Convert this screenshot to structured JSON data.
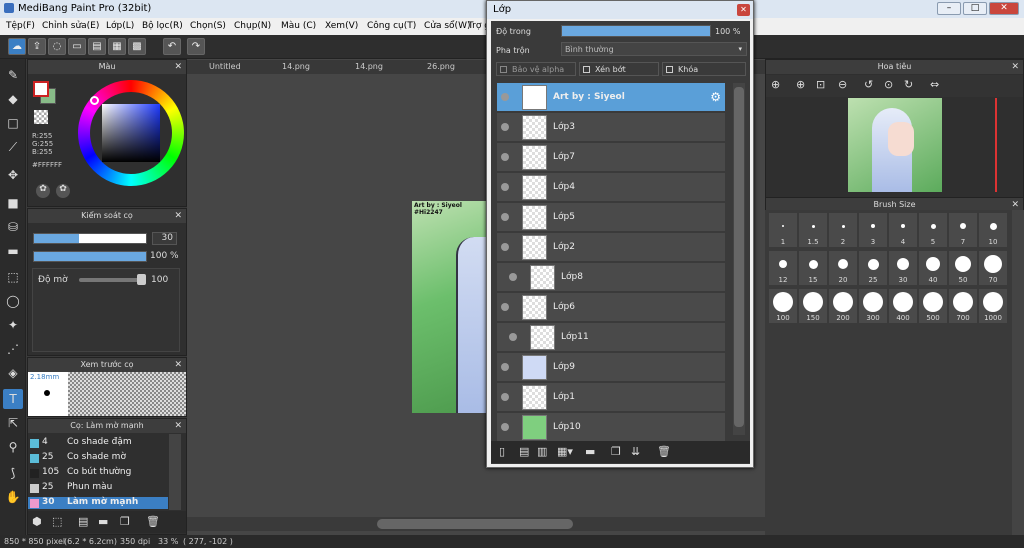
{
  "app": {
    "title": "MediBang Paint Pro (32bit)"
  },
  "menu": [
    "Tệp(F)",
    "Chỉnh sửa(E)",
    "Lớp(L)",
    "Bộ lọc(R)",
    "Chọn(S)",
    "Chụp(N)",
    "Màu (C)",
    "Xem(V)",
    "Công cụ(T)",
    "Cửa sổ(W)",
    "Trợ giúp(H)"
  ],
  "color_panel": {
    "title": "Màu",
    "r": "R:255",
    "g": "G:255",
    "b": "B:255",
    "hex": "#FFFFFF",
    "fg": "#cc2222",
    "bg": "#88bb88"
  },
  "brush_control": {
    "title": "Kiểm soát cọ",
    "size": "30",
    "opacity_pct": "100 %",
    "opacity_label": "Độ mờ",
    "opacity_value": "100",
    "size_fraction": 0.4,
    "opacity_fraction": 1.0
  },
  "brush_preview": {
    "title": "Xem trước cọ",
    "size_label": "2.18mm"
  },
  "brush_list": {
    "title": "Cọ: Làm mờ mạnh",
    "items": [
      {
        "n": "4",
        "label": "Co shade đậm",
        "color": "#5bbcd8"
      },
      {
        "n": "25",
        "label": "Co shade mờ",
        "color": "#5bbcd8"
      },
      {
        "n": "105",
        "label": "Co bút thường",
        "color": "#222222"
      },
      {
        "n": "25",
        "label": "Phun màu",
        "color": "#cccccc"
      },
      {
        "n": "30",
        "label": "Làm mờ mạnh",
        "color": "#ee99cc"
      }
    ]
  },
  "canvas_tabs": [
    "Untitled",
    "14.png",
    "14.png",
    "26.png"
  ],
  "artwork": {
    "credit": "Art by : Siyeol",
    "tag": "#Hi2247"
  },
  "layer_window": {
    "title": "Lớp",
    "opacity_label": "Độ trong",
    "opacity_value": "100 %",
    "opacity_fraction": 1.0,
    "blend_label": "Pha trộn",
    "blend_value": "Bình thường",
    "protect_alpha": "Bảo vệ alpha",
    "clip": "Xén bớt",
    "lock": "Khóa",
    "layers": [
      "Art by : Siyeol",
      "Lớp3",
      "Lớp7",
      "Lớp4",
      "Lớp5",
      "Lớp2",
      "Lớp8",
      "Lớp6",
      "Lớp11",
      "Lớp9",
      "Lớp1",
      "Lớp10"
    ]
  },
  "navigator": {
    "title": "Hoa tiêu"
  },
  "brush_size": {
    "title": "Brush Size",
    "sizes": [
      "1",
      "1.5",
      "2",
      "3",
      "4",
      "5",
      "7",
      "10",
      "12",
      "15",
      "20",
      "25",
      "30",
      "40",
      "50",
      "70",
      "100",
      "150",
      "200",
      "300",
      "400",
      "500",
      "700",
      "1000"
    ]
  },
  "status": {
    "pixels": "850 * 850 pixel",
    "cm": "(6.2 * 6.2cm)",
    "dpi": "350 dpi",
    "zoom": "33 %",
    "coords": "( 277, -102 )"
  }
}
